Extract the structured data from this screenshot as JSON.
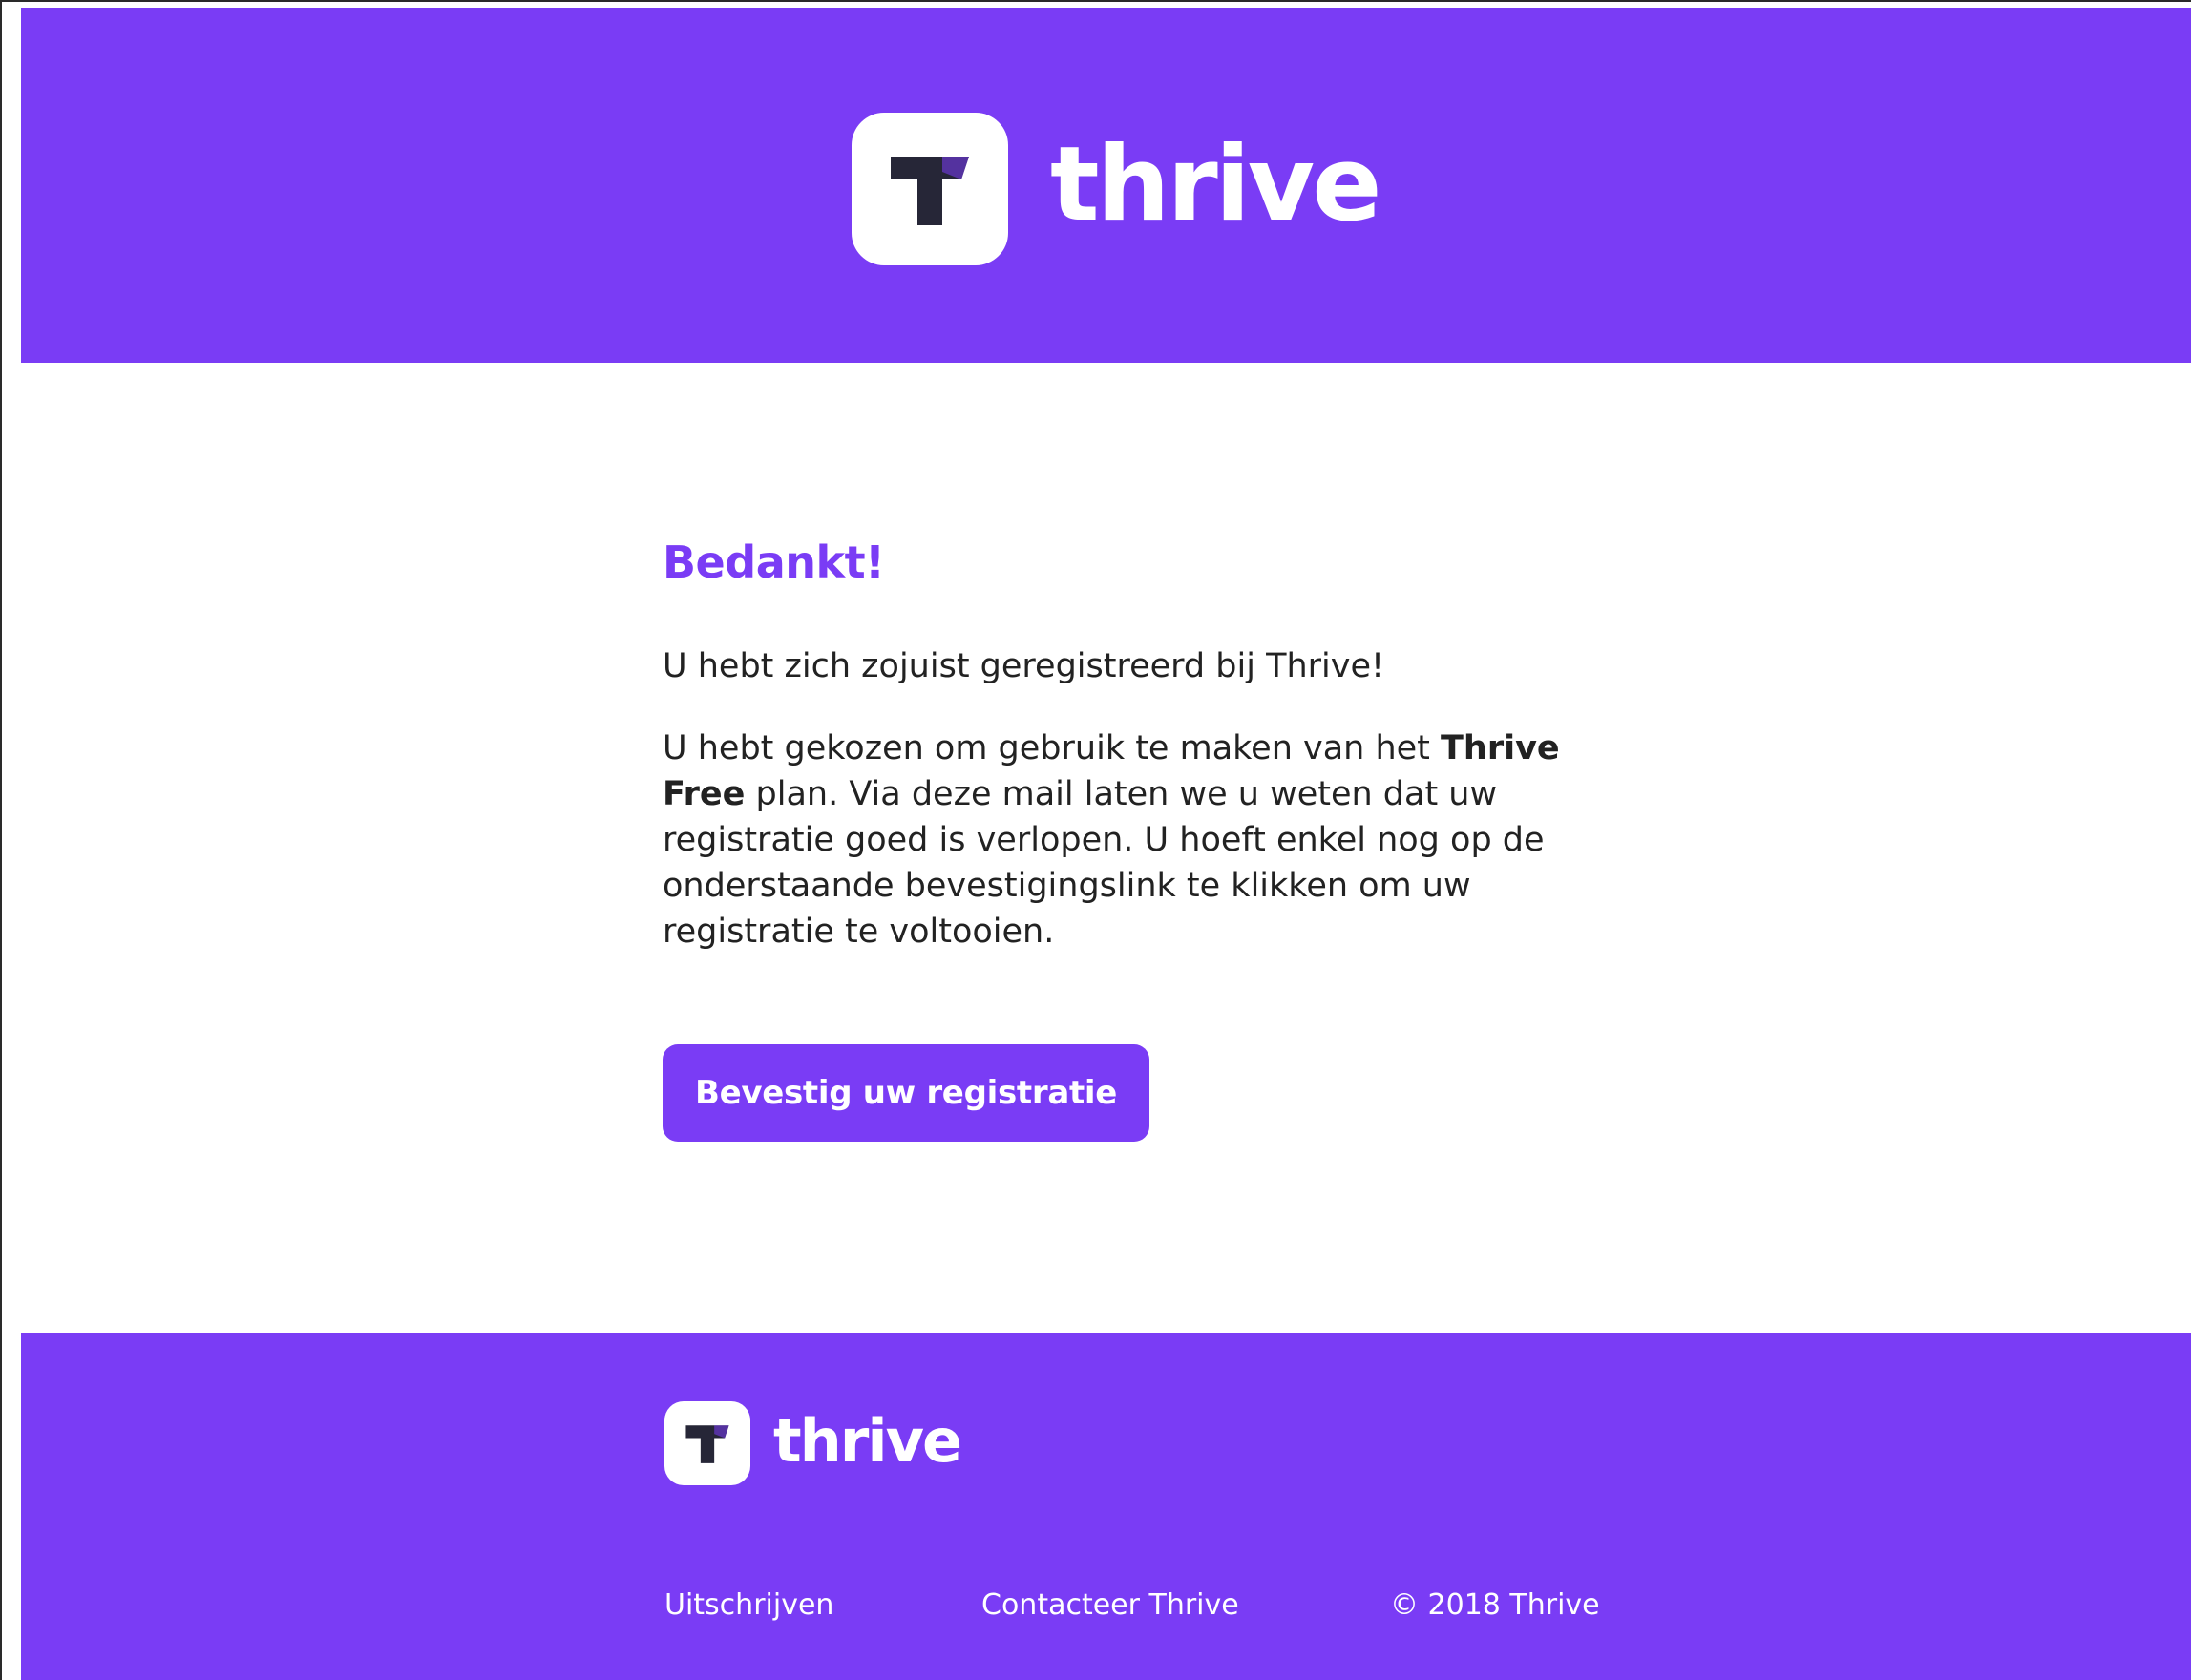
{
  "brand": {
    "name": "thrive",
    "primary_color": "#7a3cf5",
    "logo_glyph_color": "#262637"
  },
  "content": {
    "heading": "Bedankt!",
    "intro": "U hebt zich zojuist geregistreerd bij Thrive!",
    "body_prefix": "U hebt gekozen om gebruik te maken van het",
    "plan_name": "Thrive Free",
    "body_suffix": "plan. Via deze mail laten we u weten dat uw registratie goed is verlopen. U hoeft enkel nog op de onderstaande bevestigingslink te klikken om uw registratie te voltooien.",
    "cta_label": "Bevestig uw registratie"
  },
  "footer": {
    "unsubscribe": "Uitschrijven",
    "contact": "Contacteer Thrive",
    "copyright": "© 2018 Thrive"
  }
}
